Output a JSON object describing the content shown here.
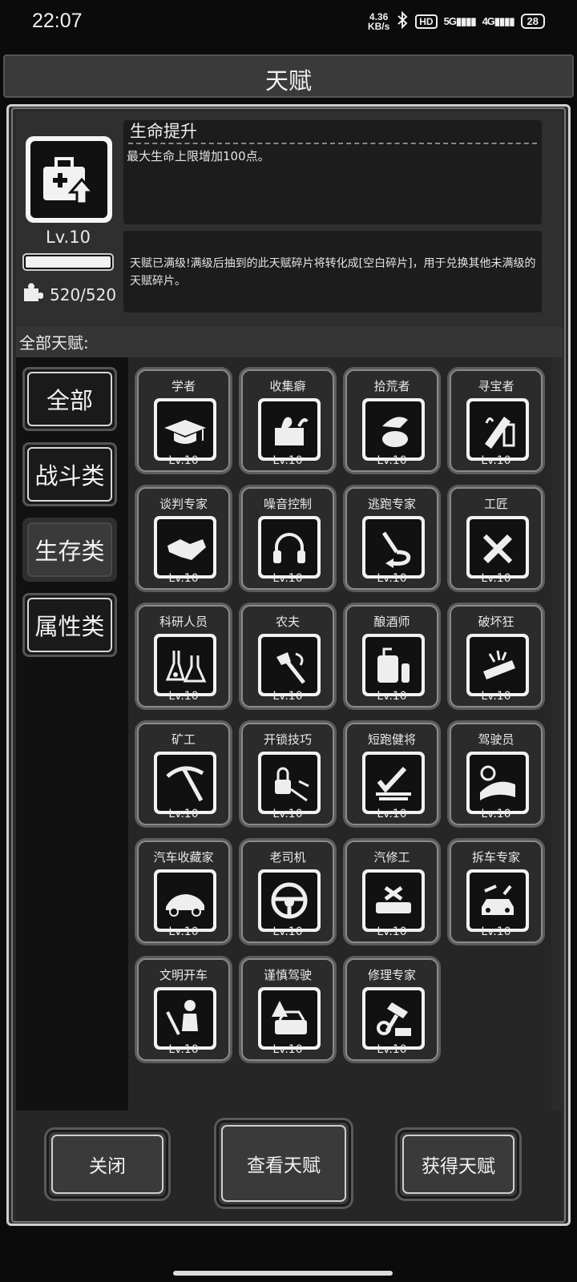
{
  "status_bar": {
    "time": "22:07",
    "net_speed_top": "4.36",
    "net_speed_bottom": "KB/s",
    "hd_badge": "HD",
    "signal_1": "5G",
    "signal_2": "4G",
    "battery": "28"
  },
  "header": {
    "title": "天赋"
  },
  "detail": {
    "icon": "first-aid-kit-upgrade-icon",
    "level": "Lv.10",
    "progress_fraction": 1.0,
    "fragments": "520/520",
    "name": "生命提升",
    "description": "最大生命上限增加100点。",
    "max_note": "天赋已满级!满级后抽到的此天赋碎片将转化成[空白碎片]，用于兑换其他未满级的天赋碎片。"
  },
  "all_label": "全部天赋:",
  "categories": [
    {
      "label": "全部",
      "active": false
    },
    {
      "label": "战斗类",
      "active": false
    },
    {
      "label": "生存类",
      "active": true
    },
    {
      "label": "属性类",
      "active": false
    }
  ],
  "talents": [
    {
      "name": "学者",
      "level": "Lv.10",
      "icon": "graduation-cap-icon"
    },
    {
      "name": "收集癖",
      "level": "Lv.10",
      "icon": "box-collect-icon"
    },
    {
      "name": "拾荒者",
      "level": "Lv.10",
      "icon": "scavenger-bag-icon"
    },
    {
      "name": "寻宝者",
      "level": "Lv.10",
      "icon": "treasure-torch-icon"
    },
    {
      "name": "谈判专家",
      "level": "Lv.10",
      "icon": "handshake-icon"
    },
    {
      "name": "噪音控制",
      "level": "Lv.10",
      "icon": "headphones-icon"
    },
    {
      "name": "逃跑专家",
      "level": "Lv.10",
      "icon": "escape-arrow-icon"
    },
    {
      "name": "工匠",
      "level": "Lv.10",
      "icon": "tools-icon"
    },
    {
      "name": "科研人员",
      "level": "Lv.10",
      "icon": "flask-icon"
    },
    {
      "name": "农夫",
      "level": "Lv.10",
      "icon": "farmer-axe-icon"
    },
    {
      "name": "酿酒师",
      "level": "Lv.10",
      "icon": "brewery-icon"
    },
    {
      "name": "破坏狂",
      "level": "Lv.10",
      "icon": "smash-icon"
    },
    {
      "name": "矿工",
      "level": "Lv.10",
      "icon": "pickaxe-icon"
    },
    {
      "name": "开锁技巧",
      "level": "Lv.10",
      "icon": "lockpick-icon"
    },
    {
      "name": "短跑健将",
      "level": "Lv.10",
      "icon": "sprint-icon"
    },
    {
      "name": "驾驶员",
      "level": "Lv.10",
      "icon": "driver-clock-icon"
    },
    {
      "name": "汽车收藏家",
      "level": "Lv.10",
      "icon": "sports-car-icon"
    },
    {
      "name": "老司机",
      "level": "Lv.10",
      "icon": "steering-wheel-icon"
    },
    {
      "name": "汽修工",
      "level": "Lv.10",
      "icon": "car-repair-icon"
    },
    {
      "name": "拆车专家",
      "level": "Lv.10",
      "icon": "car-dismantle-icon"
    },
    {
      "name": "文明开车",
      "level": "Lv.10",
      "icon": "seatbelt-icon"
    },
    {
      "name": "谨慎驾驶",
      "level": "Lv.10",
      "icon": "warning-car-icon"
    },
    {
      "name": "修理专家",
      "level": "Lv.10",
      "icon": "hammer-gear-icon"
    }
  ],
  "buttons": {
    "close": "关闭",
    "view": "查看天赋",
    "get": "获得天赋"
  }
}
